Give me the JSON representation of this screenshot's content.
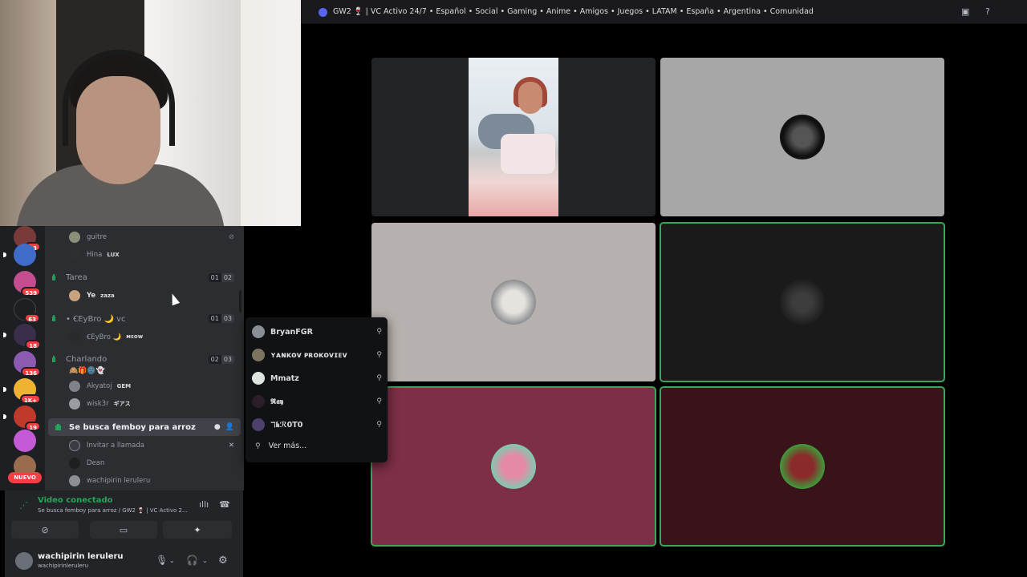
{
  "window": {
    "title": "GW2 🍷 | VC Activo 24/7 • Español • Social • Gaming • Anime • Amigos • Juegos • LATAM • España • Argentina • Comunidad"
  },
  "servers": [
    {
      "badge": "13"
    },
    {
      "badge": ""
    },
    {
      "badge": "539"
    },
    {
      "badge": "63"
    },
    {
      "badge": "18"
    },
    {
      "badge": "136"
    },
    {
      "badge": "1K+"
    },
    {
      "badge": "19"
    },
    {
      "badge": ""
    },
    {
      "badge": ""
    }
  ],
  "new_badge": "NUEVO",
  "channels": {
    "prev_members": [
      {
        "name": "guitre",
        "tag": ""
      },
      {
        "name": "Hina",
        "tag": "LUX"
      }
    ],
    "tarea": {
      "name": "Tarea",
      "count_a": "01",
      "count_b": "02",
      "member": "Ye",
      "tag": "zaza"
    },
    "eybro": {
      "name": "• ꞒEyBro 🌙 vc",
      "count_a": "01",
      "count_b": "03",
      "member": "ꞒEyBro 🌙",
      "tag": "ᴍᴇᴏᴡ"
    },
    "charlando": {
      "name": "Charlando",
      "count_a": "02",
      "count_b": "03",
      "emoji_row": "🙈🎁🌚👻",
      "members": [
        {
          "name": "Akyatoj",
          "tag": "GEM"
        },
        {
          "name": "wisk3r",
          "tag": "ギアス"
        }
      ]
    },
    "active": {
      "name": "Se busca femboy para arroz",
      "members": [
        {
          "name": "Invitar a llamada"
        },
        {
          "name": "Dean"
        },
        {
          "name": "wachipirin leruleru"
        }
      ]
    }
  },
  "voice_panel": {
    "status": "Video conectado",
    "location": "Se busca femboy para arroz / GW2 🍷 | VC Activo 2..."
  },
  "user": {
    "name": "wachipirin leruleru",
    "handle": "wachipirinleruleru"
  },
  "popup": {
    "items": [
      "BryanFGR",
      "ʏᴀɴᴋᴏᴠ ᴘʀᴏᴋᴏᴠɪᴇᴠ",
      "Mmatz",
      "𝕽𝖆𝖞",
      "ℸ𝖐ℛ0T0"
    ],
    "more": "Ver más..."
  },
  "colors": {
    "speaking": "#3ba55c",
    "tile_gray": "#a7a7a7",
    "tile_taupe": "#b6b1ae",
    "tile_dark": "#1a1a1a",
    "tile_rose": "#7d2f45",
    "tile_maroon": "#3a131a"
  },
  "icons": [
    "signal-icon",
    "waveform-icon",
    "disconnect-icon",
    "camera-off-icon",
    "screen-share-icon",
    "activities-icon",
    "mic-icon",
    "headphones-icon",
    "settings-icon",
    "add-user-icon",
    "inbox-icon",
    "help-icon"
  ]
}
